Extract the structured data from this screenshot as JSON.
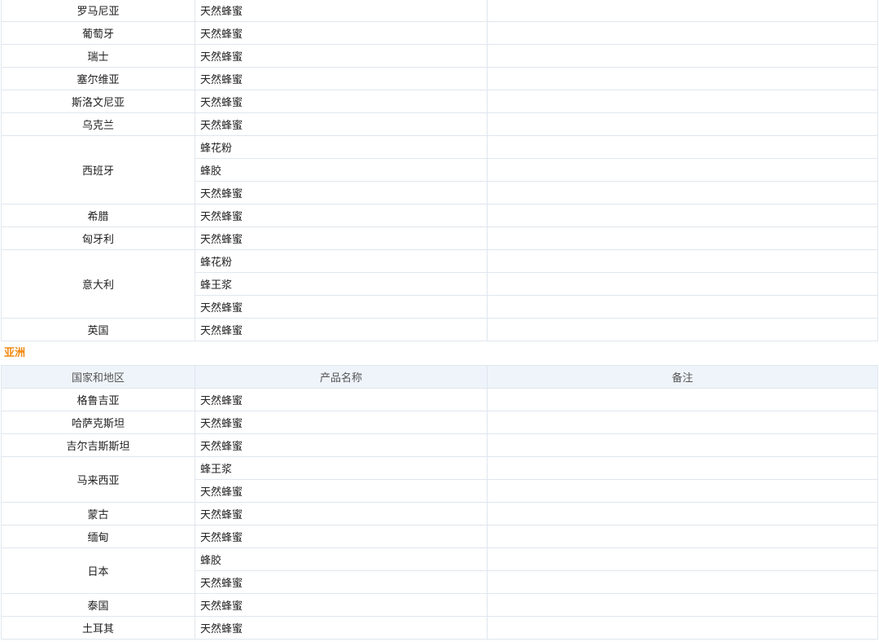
{
  "europe_rows": [
    {
      "country": "罗马尼亚",
      "products": [
        "天然蜂蜜"
      ]
    },
    {
      "country": "葡萄牙",
      "products": [
        "天然蜂蜜"
      ]
    },
    {
      "country": "瑞士",
      "products": [
        "天然蜂蜜"
      ]
    },
    {
      "country": "塞尔维亚",
      "products": [
        "天然蜂蜜"
      ]
    },
    {
      "country": "斯洛文尼亚",
      "products": [
        "天然蜂蜜"
      ]
    },
    {
      "country": "乌克兰",
      "products": [
        "天然蜂蜜"
      ]
    },
    {
      "country": "西班牙",
      "products": [
        "蜂花粉",
        "蜂胶",
        "天然蜂蜜"
      ]
    },
    {
      "country": "希腊",
      "products": [
        "天然蜂蜜"
      ]
    },
    {
      "country": "匈牙利",
      "products": [
        "天然蜂蜜"
      ]
    },
    {
      "country": "意大利",
      "products": [
        "蜂花粉",
        "蜂王浆",
        "天然蜂蜜"
      ]
    },
    {
      "country": "英国",
      "products": [
        "天然蜂蜜"
      ]
    }
  ],
  "asia_section": {
    "title": "亚洲",
    "headers": [
      "国家和地区",
      "产品名称",
      "备注"
    ],
    "rows": [
      {
        "country": "格鲁吉亚",
        "products": [
          "天然蜂蜜"
        ]
      },
      {
        "country": "哈萨克斯坦",
        "products": [
          "天然蜂蜜"
        ]
      },
      {
        "country": "吉尔吉斯斯坦",
        "products": [
          "天然蜂蜜"
        ]
      },
      {
        "country": "马来西亚",
        "products": [
          "蜂王浆",
          "天然蜂蜜"
        ]
      },
      {
        "country": "蒙古",
        "products": [
          "天然蜂蜜"
        ]
      },
      {
        "country": "缅甸",
        "products": [
          "天然蜂蜜"
        ]
      },
      {
        "country": "日本",
        "products": [
          "蜂胶",
          "天然蜂蜜"
        ]
      },
      {
        "country": "泰国",
        "products": [
          "天然蜂蜜"
        ]
      },
      {
        "country": "土耳其",
        "products": [
          "天然蜂蜜"
        ]
      }
    ]
  }
}
